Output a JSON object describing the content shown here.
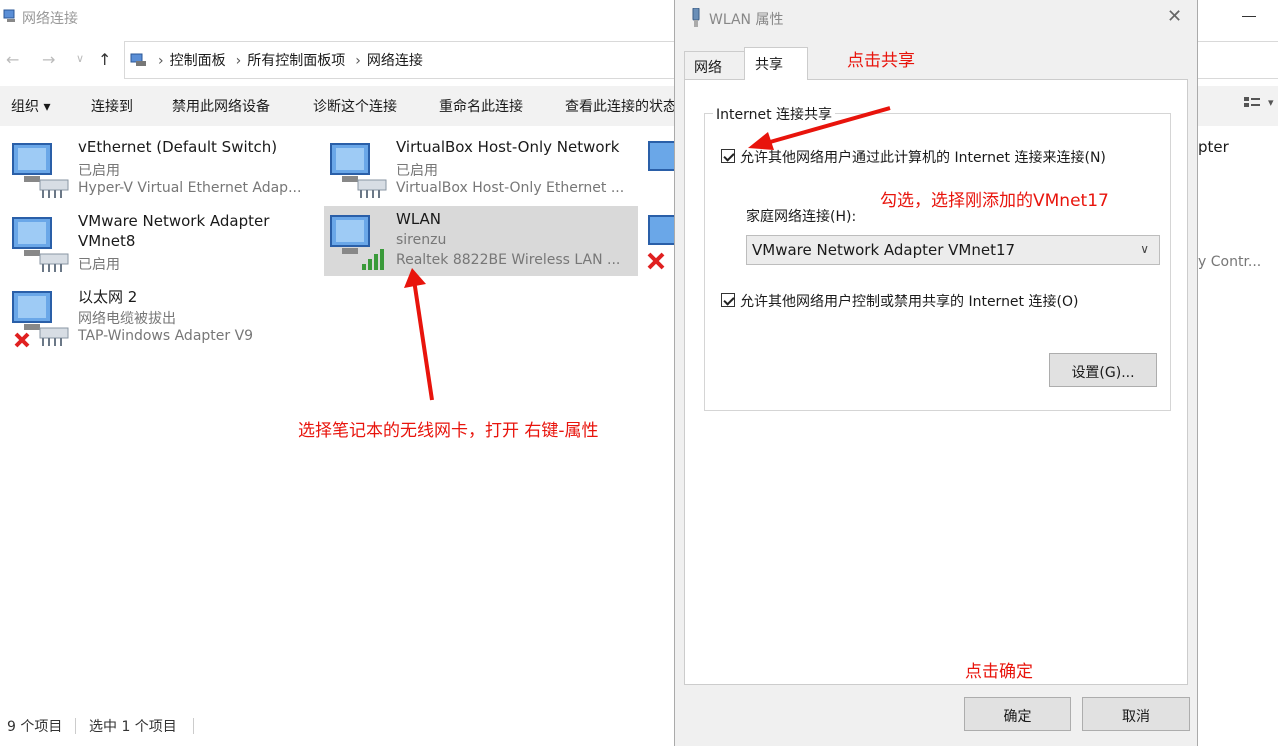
{
  "explorer": {
    "title": "网络连接",
    "breadcrumb": [
      "控制面板",
      "所有控制面板项",
      "网络连接"
    ],
    "commands": [
      "组织 ▾",
      "连接到",
      "禁用此网络设备",
      "诊断这个连接",
      "重命名此连接",
      "查看此连接的状态"
    ],
    "adapters": [
      {
        "name": "vEthernet (Default Switch)",
        "status": "已启用",
        "device": "Hyper-V Virtual Ethernet Adap..."
      },
      {
        "name": "VirtualBox Host-Only Network",
        "status": "已启用",
        "device": "VirtualBox Host-Only Ethernet ..."
      },
      {
        "name": "VMware Network Adapter",
        "name2": "VMnet8",
        "status": "已启用"
      },
      {
        "name": "WLAN",
        "status": "sirenzu",
        "device": "Realtek 8822BE Wireless LAN ..."
      },
      {
        "name": "以太网 2",
        "status": "网络电缆被拔出",
        "device": "TAP-Windows Adapter V9"
      }
    ],
    "partial": {
      "right_top": "pter",
      "right_mid": "y Contr..."
    },
    "status": {
      "count": "9 个项目",
      "selected": "选中 1 个项目"
    }
  },
  "dialog": {
    "title": "WLAN 属性",
    "close": "✕",
    "tabs": [
      "网络",
      "共享"
    ],
    "group_title": "Internet 连接共享",
    "allow_share_label": "允许其他网络用户通过此计算机的 Internet 连接来连接(N)",
    "home_label": "家庭网络连接(H):",
    "home_value": "VMware Network Adapter VMnet17",
    "allow_control_label": "允许其他网络用户控制或禁用共享的 Internet 连接(O)",
    "settings_button": "设置(G)...",
    "ok_button": "确定",
    "cancel_button": "取消"
  },
  "annotations": {
    "click_share": "点击共享",
    "check_select": "勾选，选择刚添加的VMnet17",
    "select_wireless": "选择笔记本的无线网卡，打开  右键-属性",
    "click_ok": "点击确定"
  },
  "colors": {
    "annotation": "#e8140c",
    "selected": "#d9d9d9",
    "commandbar": "#f2f2f2"
  }
}
